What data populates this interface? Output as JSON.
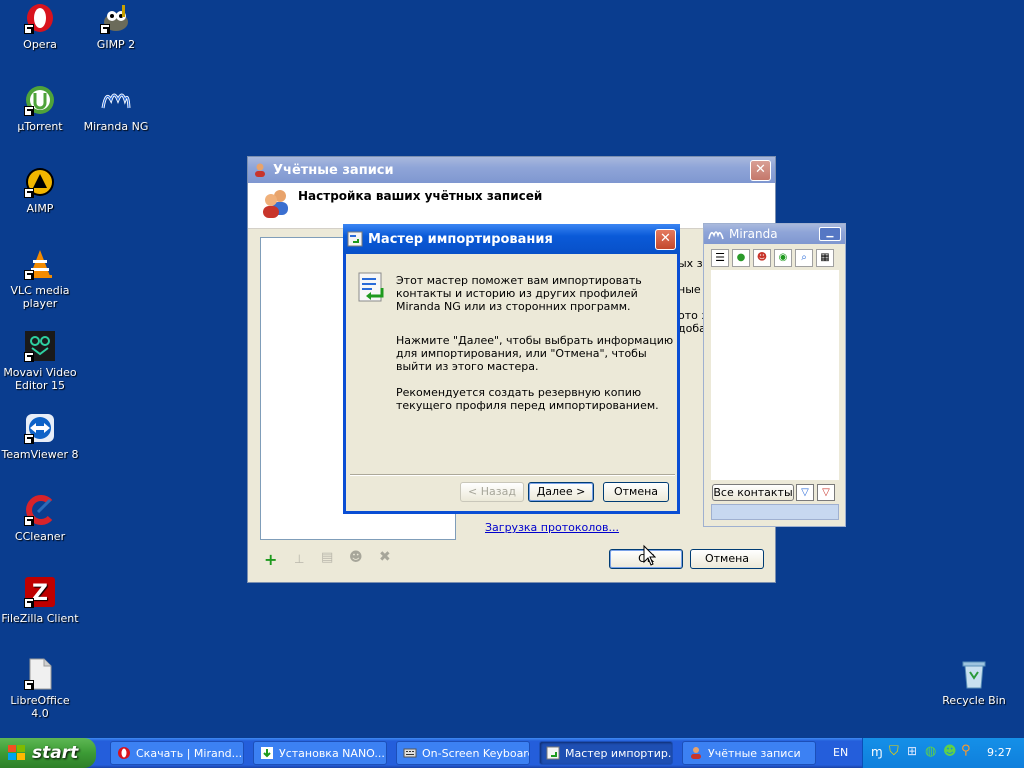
{
  "desktop": {
    "icons": [
      {
        "label": "Opera"
      },
      {
        "label": "GIMP 2"
      },
      {
        "label": "µTorrent"
      },
      {
        "label": "Miranda NG"
      },
      {
        "label": "AIMP"
      },
      {
        "label": "VLC media player"
      },
      {
        "label": "Movavi Video Editor 15"
      },
      {
        "label": "TeamViewer 8"
      },
      {
        "label": "CCleaner"
      },
      {
        "label": "FileZilla Client"
      },
      {
        "label": "LibreOffice 4.0"
      },
      {
        "label": "Recycle Bin"
      }
    ]
  },
  "accounts_window": {
    "title": "Учётные записи",
    "header": "Настройка ваших учётных записей",
    "side_lines": [
      "ых запи",
      "ные з",
      "ото заг",
      "добав"
    ],
    "links": [
      "Загрузка протоколов..."
    ],
    "ok_label": "OK",
    "cancel_label": "Отмена"
  },
  "miranda_window": {
    "title": "Miranda",
    "all_contacts_label": "Все контакты"
  },
  "wizard": {
    "title": "Мастер импортирования",
    "paragraph1": "Этот мастер поможет вам импортировать контакты и историю из других профилей Miranda NG или из сторонних программ.",
    "paragraph2": "Нажмите \"Далее\", чтобы выбрать информацию для импортирования, или \"Отмена\", чтобы выйти из этого мастера.",
    "paragraph3": "Рекомендуется создать резервную копию текущего профиля перед импортированием.",
    "back_label": "< Назад",
    "next_label": "Далее >",
    "cancel_label": "Отмена"
  },
  "taskbar": {
    "start_label": "start",
    "tasks": [
      {
        "label": "Скачать | Mirand..."
      },
      {
        "label": "Установка NANO..."
      },
      {
        "label": "On-Screen Keyboard"
      },
      {
        "label": "Мастер импортир..."
      },
      {
        "label": "Учётные записи"
      }
    ],
    "language": "EN",
    "clock": "9:27"
  },
  "colors": {
    "desktop_bg": "#0a3d8f",
    "title_active": "#0a5ad8",
    "window_face": "#ece9d8",
    "link": "#0000cc"
  }
}
